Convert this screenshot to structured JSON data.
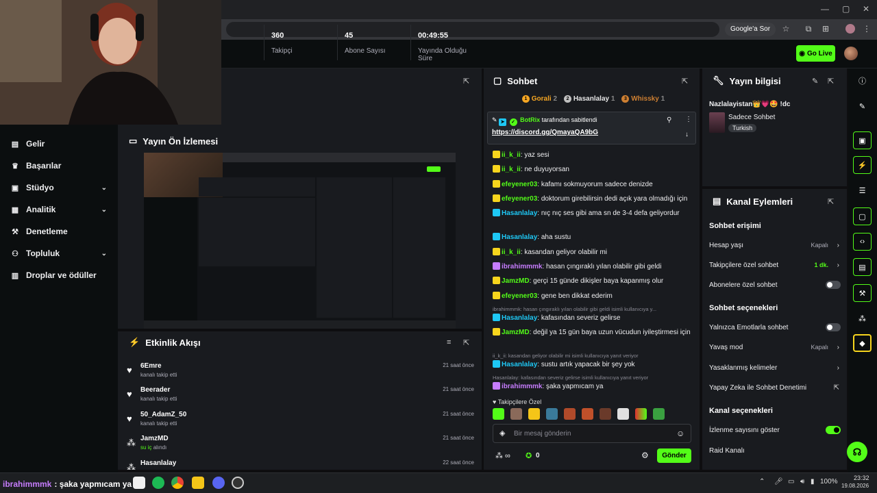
{
  "browser": {
    "google_button": "Google'a Sor",
    "window_controls": [
      "—",
      "▢",
      "✕"
    ]
  },
  "header": {
    "go_live_label": "Go Live"
  },
  "sidebar": {
    "items": [
      {
        "label": "Gelir",
        "icon": "money-icon",
        "has_children": false
      },
      {
        "label": "Başarılar",
        "icon": "trophy-icon",
        "has_children": false
      },
      {
        "label": "Stüdyo",
        "icon": "studio-icon",
        "has_children": true
      },
      {
        "label": "Analitik",
        "icon": "analytics-icon",
        "has_children": true
      },
      {
        "label": "Denetleme",
        "icon": "moderation-icon",
        "has_children": false
      },
      {
        "label": "Topluluk",
        "icon": "community-icon",
        "has_children": true
      },
      {
        "label": "Droplar ve ödüller",
        "icon": "drops-icon",
        "has_children": false
      }
    ]
  },
  "stats": [
    {
      "value": "360",
      "label": "Takipçi"
    },
    {
      "value": "45",
      "label": "Abone Sayısı"
    },
    {
      "value": "00:49:55",
      "label": "Yayında Olduğu Süre"
    }
  ],
  "preview": {
    "title": "Yayın Ön İzlemesi"
  },
  "activity": {
    "title": "Etkinlik Akışı",
    "rows": [
      {
        "name": "6Emre",
        "action": "kanalı takip etti",
        "time": "21 saat önce",
        "icon": "heart-icon"
      },
      {
        "name": "Beerader",
        "action": "kanalı takip etti",
        "time": "21 saat önce",
        "icon": "heart-icon"
      },
      {
        "name": "50_AdamZ_50",
        "action": "kanalı takip etti",
        "time": "21 saat önce",
        "icon": "heart-icon"
      },
      {
        "name": "JamzMD",
        "action_highlight": "su iç",
        "action": "alındı",
        "time": "21 saat önce",
        "icon": "points-icon"
      },
      {
        "name": "Hasanlalay",
        "action": "",
        "time": "22 saat önce",
        "icon": "points-icon"
      }
    ]
  },
  "chat": {
    "title": "Sohbet",
    "leaderboard": [
      {
        "rank": "1",
        "name": "Gorali",
        "count": "2",
        "color": "#f5a623"
      },
      {
        "rank": "2",
        "name": "Hasanlalay",
        "count": "1",
        "color": "#c0c0c0"
      },
      {
        "rank": "3",
        "name": "Whissky",
        "count": "1",
        "color": "#cd7f32"
      }
    ],
    "pinned": {
      "pinned_by": "BotRix",
      "pinned_suffix": "tarafından sabitlendi",
      "link": "https://discord.gg/QmayaQA9bG"
    },
    "messages": [
      {
        "user": "ii_k_ii",
        "color": "#53fc18",
        "text": "yaz sesi"
      },
      {
        "user": "ii_k_ii",
        "color": "#53fc18",
        "text": "ne duyuyorsan"
      },
      {
        "user": "efeyener03",
        "color": "#53fc18",
        "text": "kafamı sokmuyorum sadece denizde"
      },
      {
        "user": "efeyener03",
        "color": "#53fc18",
        "text": "doktorum girebilirsin dedi açık yara olmadığı için"
      },
      {
        "user": "Hasanlalay",
        "color": "#1ec8f5",
        "text": "nıç nıç ses gibi ama sn de 3-4 defa geliyordur"
      },
      {
        "user": "Hasanlalay",
        "color": "#1ec8f5",
        "text": "aha sustu"
      },
      {
        "user": "ii_k_ii",
        "color": "#53fc18",
        "text": "kasandan geliyor olabilir mi"
      },
      {
        "user": "ibrahimmmk",
        "color": "#c77dff",
        "text": "hasan çıngıraklı yılan olabilir gibi geldi"
      },
      {
        "user": "JamzMD",
        "color": "#53fc18",
        "text": "gerçi 15 günde dikişler baya kapanmış olur"
      },
      {
        "user": "efeyener03",
        "color": "#53fc18",
        "text": "gene ben dikkat ederim"
      },
      {
        "reply_to": "ibrahimmmk: hasan çıngıraklı yılan olabilir gibi geldi isimli kullanıcıya y...",
        "user": "Hasanlalay",
        "color": "#1ec8f5",
        "text": "kafasından severiz gelirse"
      },
      {
        "user": "JamzMD",
        "color": "#53fc18",
        "text": "değil ya 15 gün baya uzun vücudun iyileştirmesi için"
      },
      {
        "reply_to": "ii_k_ii: kasandan geliyor olabilir mi isimli kullanıcıya yanıt veriyor",
        "user": "Hasanlalay",
        "color": "#1ec8f5",
        "text": "sustu artık yapacak bir şey yok"
      },
      {
        "reply_to": "Hasanlalay: kafasından severiz gelirse isimli kullanıcıya yanıt veriyor",
        "user": "ibrahimmmk",
        "color": "#c77dff",
        "text": "şaka yapmıcam ya"
      }
    ],
    "emote_section_label": "Takipçilere Özel",
    "input_placeholder": "Bir mesaj gönderin",
    "points_value": "0",
    "send_label": "Gönder"
  },
  "stream_info": {
    "title": "Yayın bilgisi",
    "stream_title": "Nazlalayistan👑💗🤩 !dc",
    "category": "Sadece Sohbet",
    "language_tag": "Turkish"
  },
  "channel_actions": {
    "title": "Kanal Eylemleri",
    "chat_access_title": "Sohbet erişimi",
    "chat_access": [
      {
        "label": "Hesap yaşı",
        "value": "Kapalı",
        "type": "arrow"
      },
      {
        "label": "Takipçilere özel sohbet",
        "value": "1 dk.",
        "type": "arrow",
        "value_color": "#53fc18"
      },
      {
        "label": "Abonelere özel sohbet",
        "type": "toggle",
        "on": false
      }
    ],
    "chat_options_title": "Sohbet seçenekleri",
    "chat_options": [
      {
        "label": "Yalnızca Emotlarla sohbet",
        "type": "toggle",
        "on": false
      },
      {
        "label": "Yavaş mod",
        "value": "Kapalı",
        "type": "arrow"
      },
      {
        "label": "Yasaklanmış kelimeler",
        "type": "arrow"
      },
      {
        "label": "Yapay Zeka ile Sohbet Denetimi",
        "type": "external"
      }
    ],
    "channel_options_title": "Kanal seçenekleri",
    "channel_options": [
      {
        "label": "İzlenme sayısını göster",
        "type": "toggle",
        "on": true
      },
      {
        "label": "Raid Kanalı",
        "type": "none"
      }
    ]
  },
  "taskbar": {
    "overlay_user": "ibrahimmmk",
    "overlay_text": ": şaka yapmıcam ya",
    "battery": "100%",
    "time": "23:32",
    "date": "19.08.2026"
  },
  "colors": {
    "accent": "#53fc18",
    "panel": "#191b1f",
    "background": "#0e0e10"
  }
}
